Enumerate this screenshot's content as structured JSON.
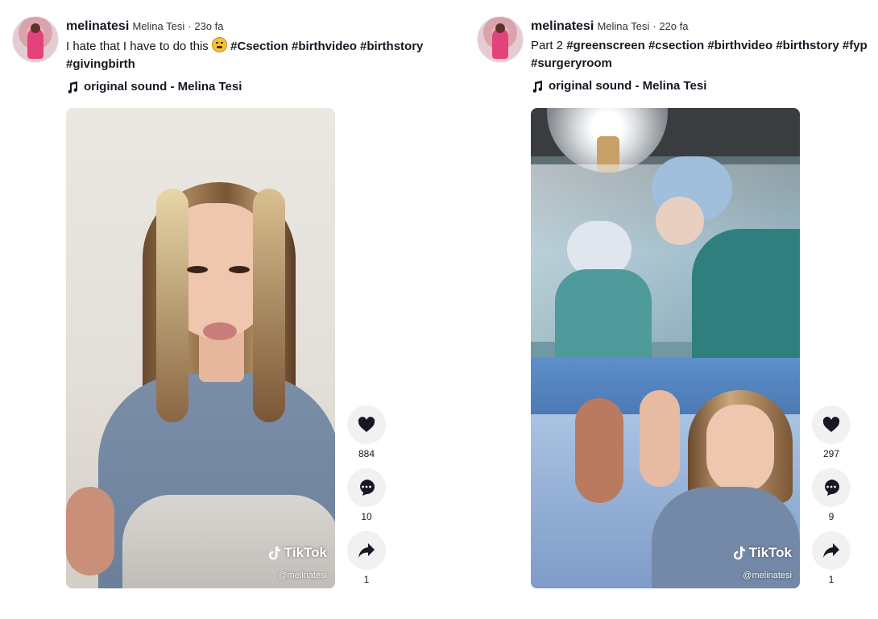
{
  "posts": [
    {
      "username": "melinatesi",
      "display_name": "Melina Tesi",
      "time": "· 23o fa",
      "caption_text": "I hate that I have to do this",
      "caption_emoji": "weary-face-emoji",
      "hashtags_line1": [
        "#Csection",
        "#birthvideo",
        "#birthstory"
      ],
      "hashtags_line2": [
        "#givingbirth"
      ],
      "sound": "original sound - Melina Tesi",
      "watermark_brand": "TikTok",
      "watermark_user": "@melinatesi",
      "likes": "884",
      "comments": "10",
      "shares": "1"
    },
    {
      "username": "melinatesi",
      "display_name": "Melina Tesi",
      "time": "· 22o fa",
      "caption_text": "Part 2",
      "hashtags_line1": [
        "#greenscreen",
        "#csection",
        "#birthvideo",
        "#birthstory",
        "#fyp"
      ],
      "hashtags_line2": [
        "#surgeryroom"
      ],
      "sound": "original sound - Melina Tesi",
      "watermark_brand": "TikTok",
      "watermark_user": "@melinatesi",
      "likes": "297",
      "comments": "9",
      "shares": "1"
    }
  ],
  "icons": {
    "music": "music-note-icon",
    "like": "heart-icon",
    "comment": "comment-icon",
    "share": "share-arrow-icon",
    "tiktok": "tiktok-logo-icon"
  },
  "colors": {
    "text": "#161823",
    "action_bg": "#f1f1f2"
  }
}
